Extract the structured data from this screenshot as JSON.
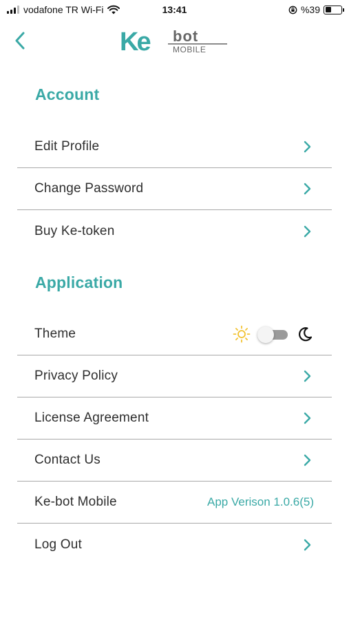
{
  "status_bar": {
    "carrier": "vodafone TR Wi-Fi",
    "time": "13:41",
    "battery_text": "%39",
    "battery_level": 0.39
  },
  "header": {
    "logo_ke": "Ke",
    "logo_bot": "bot",
    "logo_mobile": "MOBILE",
    "back_icon": "chevron-left-icon"
  },
  "account": {
    "title": "Account",
    "items": [
      {
        "label": "Edit Profile"
      },
      {
        "label": "Change Password"
      },
      {
        "label": "Buy Ke-token"
      }
    ]
  },
  "application": {
    "title": "Application",
    "theme": {
      "label": "Theme",
      "dark_mode": false,
      "light_icon": "sun-icon",
      "dark_icon": "moon-icon"
    },
    "items": [
      {
        "label": "Privacy Policy"
      },
      {
        "label": "License Agreement"
      },
      {
        "label": "Contact Us"
      }
    ],
    "version": {
      "label": "Ke-bot Mobile",
      "value": "App Verison 1.0.6(5)"
    },
    "logout": {
      "label": "Log Out"
    }
  },
  "colors": {
    "accent": "#3aa9a6",
    "logo_dark": "#666666",
    "sun": "#f2c230",
    "divider": "#a9a9a9"
  }
}
